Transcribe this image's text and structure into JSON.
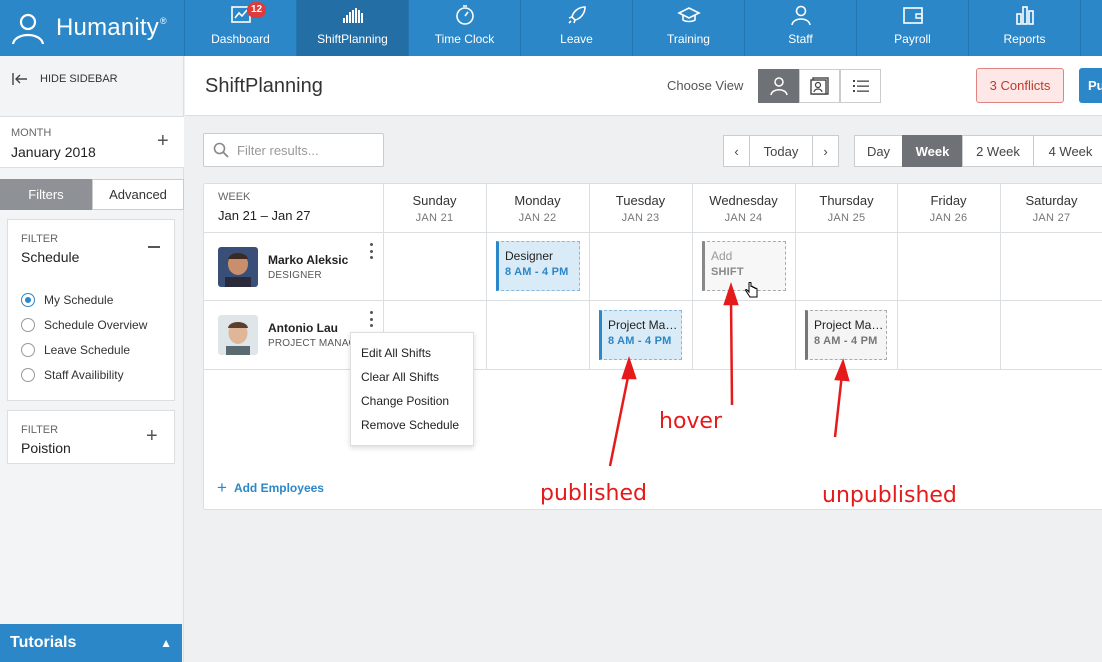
{
  "brand": {
    "name": "Humanity",
    "reg": "®"
  },
  "nav": [
    {
      "label": "Dashboard",
      "icon": "dashboard-icon",
      "badge": "12"
    },
    {
      "label": "ShiftPlanning",
      "icon": "shiftplanning-icon",
      "active": true
    },
    {
      "label": "Time Clock",
      "icon": "timeclock-icon"
    },
    {
      "label": "Leave",
      "icon": "leave-rocket-icon"
    },
    {
      "label": "Training",
      "icon": "training-cap-icon"
    },
    {
      "label": "Staff",
      "icon": "staff-person-icon"
    },
    {
      "label": "Payroll",
      "icon": "payroll-wallet-icon"
    },
    {
      "label": "Reports",
      "icon": "reports-chart-icon"
    }
  ],
  "sidebar": {
    "hide_label": "HIDE SIDEBAR",
    "month_label": "MONTH",
    "month_value": "January 2018",
    "tabs": [
      "Filters",
      "Advanced"
    ],
    "filter1": {
      "label": "FILTER",
      "value": "Schedule"
    },
    "options": [
      "My Schedule",
      "Schedule Overview",
      "Leave Schedule",
      "Staff Availibility"
    ],
    "selected_option": "My Schedule",
    "filter2": {
      "label": "FILTER",
      "value": "Poistion"
    },
    "tutorials": "Tutorials"
  },
  "header": {
    "title": "ShiftPlanning",
    "choose_view": "Choose View",
    "conflicts": "3 Conflicts",
    "publish": "Publish"
  },
  "toolbar": {
    "search_placeholder": "Filter results...",
    "today": "Today",
    "views": [
      "Day",
      "Week",
      "2 Week",
      "4 Week"
    ],
    "active_view": "Week"
  },
  "grid": {
    "week_label": "WEEK",
    "week_range": "Jan 21 – Jan 27",
    "days": [
      {
        "name": "Sunday",
        "date": "JAN 21"
      },
      {
        "name": "Monday",
        "date": "JAN 22"
      },
      {
        "name": "Tuesday",
        "date": "JAN 23"
      },
      {
        "name": "Wednesday",
        "date": "JAN 24"
      },
      {
        "name": "Thursday",
        "date": "JAN 25"
      },
      {
        "name": "Friday",
        "date": "JAN 26"
      },
      {
        "name": "Saturday",
        "date": "JAN 27"
      }
    ],
    "employees": [
      {
        "name": "Marko Aleksic",
        "role": "DESIGNER"
      },
      {
        "name": "Antonio Lau",
        "role": "PROJECT MANAGER"
      }
    ],
    "shifts": {
      "marko_mon": {
        "title": "Designer",
        "time": "8 AM - 4 PM",
        "state": "published"
      },
      "marko_wed": {
        "title": "Add",
        "time": "SHIFT",
        "state": "hover"
      },
      "antonio_tue": {
        "title": "Project Manager",
        "time": "8 AM - 4 PM",
        "state": "published"
      },
      "antonio_thu": {
        "title": "Project Manager",
        "time": "8 AM - 4 PM",
        "state": "unpublished"
      }
    },
    "context_menu": [
      "Edit All Shifts",
      "Clear All Shifts",
      "Change Position",
      "Remove Schedule"
    ],
    "add_employees": "Add Employees"
  },
  "annotations": {
    "hover": "hover",
    "published": "published",
    "unpublished": "unpublished",
    "color": "#e51b1b"
  },
  "colors": {
    "brand": "#2b87c7",
    "nav_active": "#236fa5",
    "conflict": "#c0392b",
    "badge": "#e03a3a"
  }
}
